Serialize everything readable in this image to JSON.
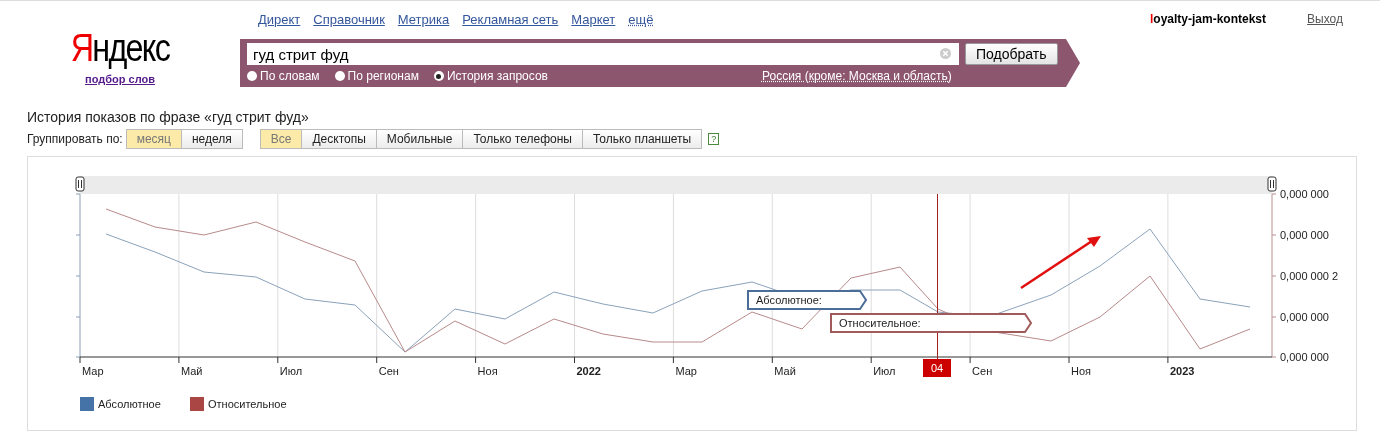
{
  "header": {
    "logo": "Яндекс",
    "logo_link": "подбор слов",
    "nav": [
      "Директ",
      "Справочник",
      "Метрика",
      "Рекламная сеть",
      "Маркет",
      "ещё"
    ],
    "user": "loyalty-jam-kontekst",
    "logout": "Выход"
  },
  "search": {
    "value": "гуд стрит фуд",
    "button": "Подобрать",
    "modes": [
      {
        "label": "По словам",
        "selected": false
      },
      {
        "label": "По регионам",
        "selected": false
      },
      {
        "label": "История запросов",
        "selected": true
      }
    ],
    "region": "Россия (кроме: Москва и область)"
  },
  "title": "История показов по фразе «гуд стрит фуд»",
  "grouping": {
    "label": "Группировать по:",
    "options": [
      {
        "label": "месяц",
        "selected": true
      },
      {
        "label": "неделя",
        "selected": false
      }
    ]
  },
  "devices": [
    {
      "label": "Все",
      "selected": true
    },
    {
      "label": "Десктопы",
      "selected": false
    },
    {
      "label": "Мобильные",
      "selected": false
    },
    {
      "label": "Только телефоны",
      "selected": false
    },
    {
      "label": "Только планшеты",
      "selected": false
    }
  ],
  "help": "?",
  "chart": {
    "x_labels": [
      {
        "label": "Мар",
        "bold": false
      },
      {
        "label": "Май",
        "bold": false
      },
      {
        "label": "Июл",
        "bold": false
      },
      {
        "label": "Сен",
        "bold": false
      },
      {
        "label": "Ноя",
        "bold": false
      },
      {
        "label": "2022",
        "bold": true
      },
      {
        "label": "Мар",
        "bold": false
      },
      {
        "label": "Май",
        "bold": false
      },
      {
        "label": "Июл",
        "bold": false
      },
      {
        "label": "Сен",
        "bold": false
      },
      {
        "label": "Ноя",
        "bold": false
      },
      {
        "label": "2023",
        "bold": true
      }
    ],
    "y_labels": [
      "0,000 000",
      "0,000 000",
      "0,000 000 2",
      "0,000 000",
      "0,000 000"
    ],
    "marker": "04",
    "tooltips": [
      {
        "label": "Абсолютное:",
        "color": "#4a6e98"
      },
      {
        "label": "Относительное:",
        "color": "#a05a5a"
      }
    ],
    "legend": [
      {
        "label": "Абсолютное",
        "color": "#4572a7"
      },
      {
        "label": "Относительное",
        "color": "#aa4643"
      }
    ]
  }
}
